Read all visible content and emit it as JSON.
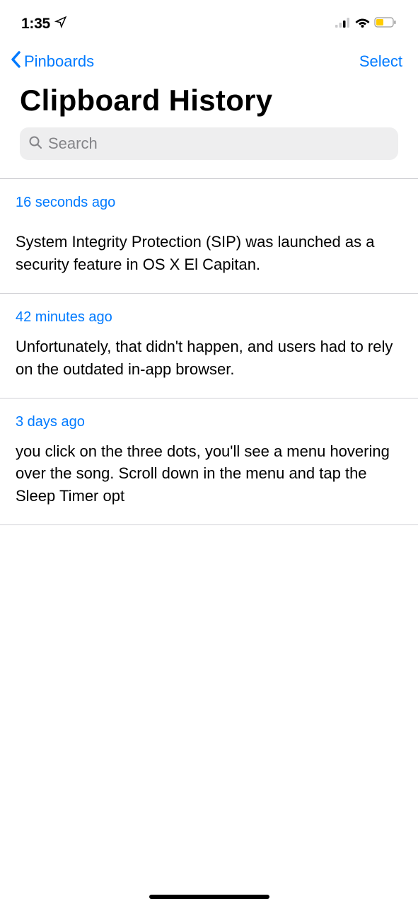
{
  "status": {
    "time": "1:35"
  },
  "nav": {
    "back_label": "Pinboards",
    "select_label": "Select"
  },
  "title": "Clipboard History",
  "search": {
    "placeholder": "Search"
  },
  "items": [
    {
      "timestamp": "16 seconds ago",
      "content": "System Integrity Protection (SIP) was launched as a security feature in OS X El Capitan."
    },
    {
      "timestamp": "42 minutes ago",
      "content": "Unfortunately, that didn't happen, and users had to rely on the outdated in-app browser."
    },
    {
      "timestamp": "3 days ago",
      "content": "you click on the three dots, you'll see a menu hovering over the song. Scroll down in the menu and tap the Sleep Timer opt"
    }
  ]
}
